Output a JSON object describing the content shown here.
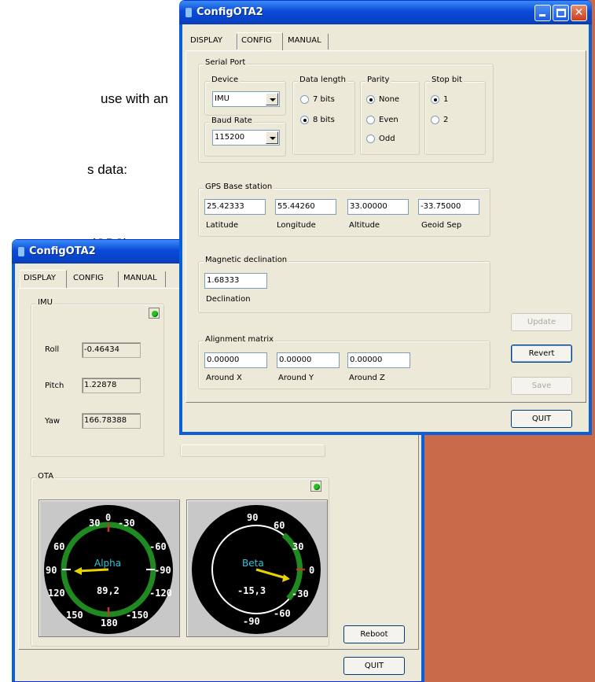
{
  "background_doc": {
    "lines": [
      "use with an",
      "s data:",
      "on (GPS)"
    ]
  },
  "config_window": {
    "title": "ConfigOTA2",
    "tabs": [
      "DISPLAY",
      "CONFIG",
      "MANUAL"
    ],
    "active_tab": "CONFIG",
    "serial_port": {
      "legend": "Serial Port",
      "device": {
        "legend": "Device",
        "value": "IMU"
      },
      "baud_rate": {
        "legend": "Baud Rate",
        "value": "115200"
      },
      "data_length": {
        "legend": "Data length",
        "options": [
          "7 bits",
          "8 bits"
        ],
        "selected": "8 bits"
      },
      "parity": {
        "legend": "Parity",
        "options": [
          "None",
          "Even",
          "Odd"
        ],
        "selected": "None"
      },
      "stop_bit": {
        "legend": "Stop bit",
        "options": [
          "1",
          "2"
        ],
        "selected": "1"
      }
    },
    "gps_base": {
      "legend": "GPS Base station",
      "latitude": {
        "value": "25.42333",
        "label": "Latitude"
      },
      "longitude": {
        "value": "55.44260",
        "label": "Longitude"
      },
      "altitude": {
        "value": "33.00000",
        "label": "Altitude"
      },
      "geoid_sep": {
        "value": "-33.75000",
        "label": "Geoid Sep"
      }
    },
    "magnetic": {
      "legend": "Magnetic declination",
      "declination": {
        "value": "1.68333",
        "label": "Declination"
      }
    },
    "alignment": {
      "legend": "Alignment matrix",
      "x": {
        "value": "0.00000",
        "label": "Around X"
      },
      "y": {
        "value": "0.00000",
        "label": "Around Y"
      },
      "z": {
        "value": "0.00000",
        "label": "Around Z"
      }
    },
    "buttons": {
      "update": "Update",
      "revert": "Revert",
      "save": "Save",
      "quit": "QUIT"
    }
  },
  "display_window": {
    "title": "ConfigOTA2",
    "tabs": [
      "DISPLAY",
      "CONFIG",
      "MANUAL"
    ],
    "active_tab": "DISPLAY",
    "imu": {
      "legend": "IMU",
      "roll": {
        "label": "Roll",
        "value": "-0.46434"
      },
      "pitch": {
        "label": "Pitch",
        "value": "1.22878"
      },
      "yaw": {
        "label": "Yaw",
        "value": "166.78388"
      }
    },
    "ota": {
      "legend": "OTA",
      "alpha": {
        "name": "Alpha",
        "reading": "89,2",
        "ticks": [
          "30",
          "0",
          "-30",
          "60",
          "-60",
          "90",
          "-90",
          "120",
          "-120",
          "150",
          "180",
          "-150"
        ]
      },
      "beta": {
        "name": "Beta",
        "reading": "-15,3",
        "ticks": [
          "90",
          "60",
          "30",
          "0",
          "-30",
          "-60",
          "-90"
        ]
      }
    },
    "buttons": {
      "reboot": "Reboot",
      "quit": "QUIT"
    }
  },
  "colors": {
    "titlebar": "#0a4ad8",
    "accent_orange": "#c96a4a",
    "led_green": "#21c521",
    "gauge_ring_green": "#1f8a1f",
    "needle_yellow": "#e8d200",
    "gauge_label_cyan": "#2fc4d8"
  }
}
